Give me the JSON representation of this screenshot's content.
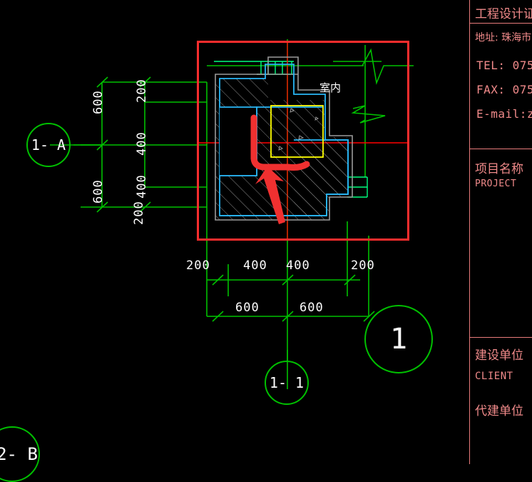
{
  "app": {
    "background": "#000000",
    "kind": "cad-drawing-viewport"
  },
  "colors": {
    "grid_green": "#00c000",
    "dim_text": "#ffffff",
    "axis_red": "#ff0000",
    "selection_red": "#ff2d2d",
    "annotation_red": "#f03030",
    "wall_cyan": "#29b6f6",
    "wall_gray": "#9a9a9a",
    "highlight_yellow": "#ffff00",
    "titleblock_pink": "#f08a8a",
    "hatch_gray": "#8c8c8c"
  },
  "drawing": {
    "indoor_label": "室内",
    "detail_bubble": "1",
    "grid_bubbles": [
      {
        "name": "grid-bubble-1-a",
        "label": "1- A"
      },
      {
        "name": "grid-bubble-1-1",
        "label": "1- 1"
      },
      {
        "name": "grid-bubble-2-b",
        "label": "2- B"
      }
    ],
    "dimensions": {
      "left_outer_chain": [
        "600",
        "600"
      ],
      "left_inner_chain": [
        "200",
        "400",
        "400"
      ],
      "left_lower_note": "200",
      "bottom_inner_chain": [
        "200",
        "400",
        "400",
        "200"
      ],
      "bottom_outer_chain": [
        "600",
        "600"
      ]
    }
  },
  "titleblock": {
    "cert_title": "工程设计证",
    "address": "地址: 珠海市",
    "tel": "TEL: 075",
    "fax": "FAX: 075",
    "email": "E-mail:z",
    "project_cn": "项目名称",
    "project_en": "PROJECT",
    "client_cn": "建设单位",
    "client_en": "CLIENT",
    "agent_cn": "代建单位"
  }
}
